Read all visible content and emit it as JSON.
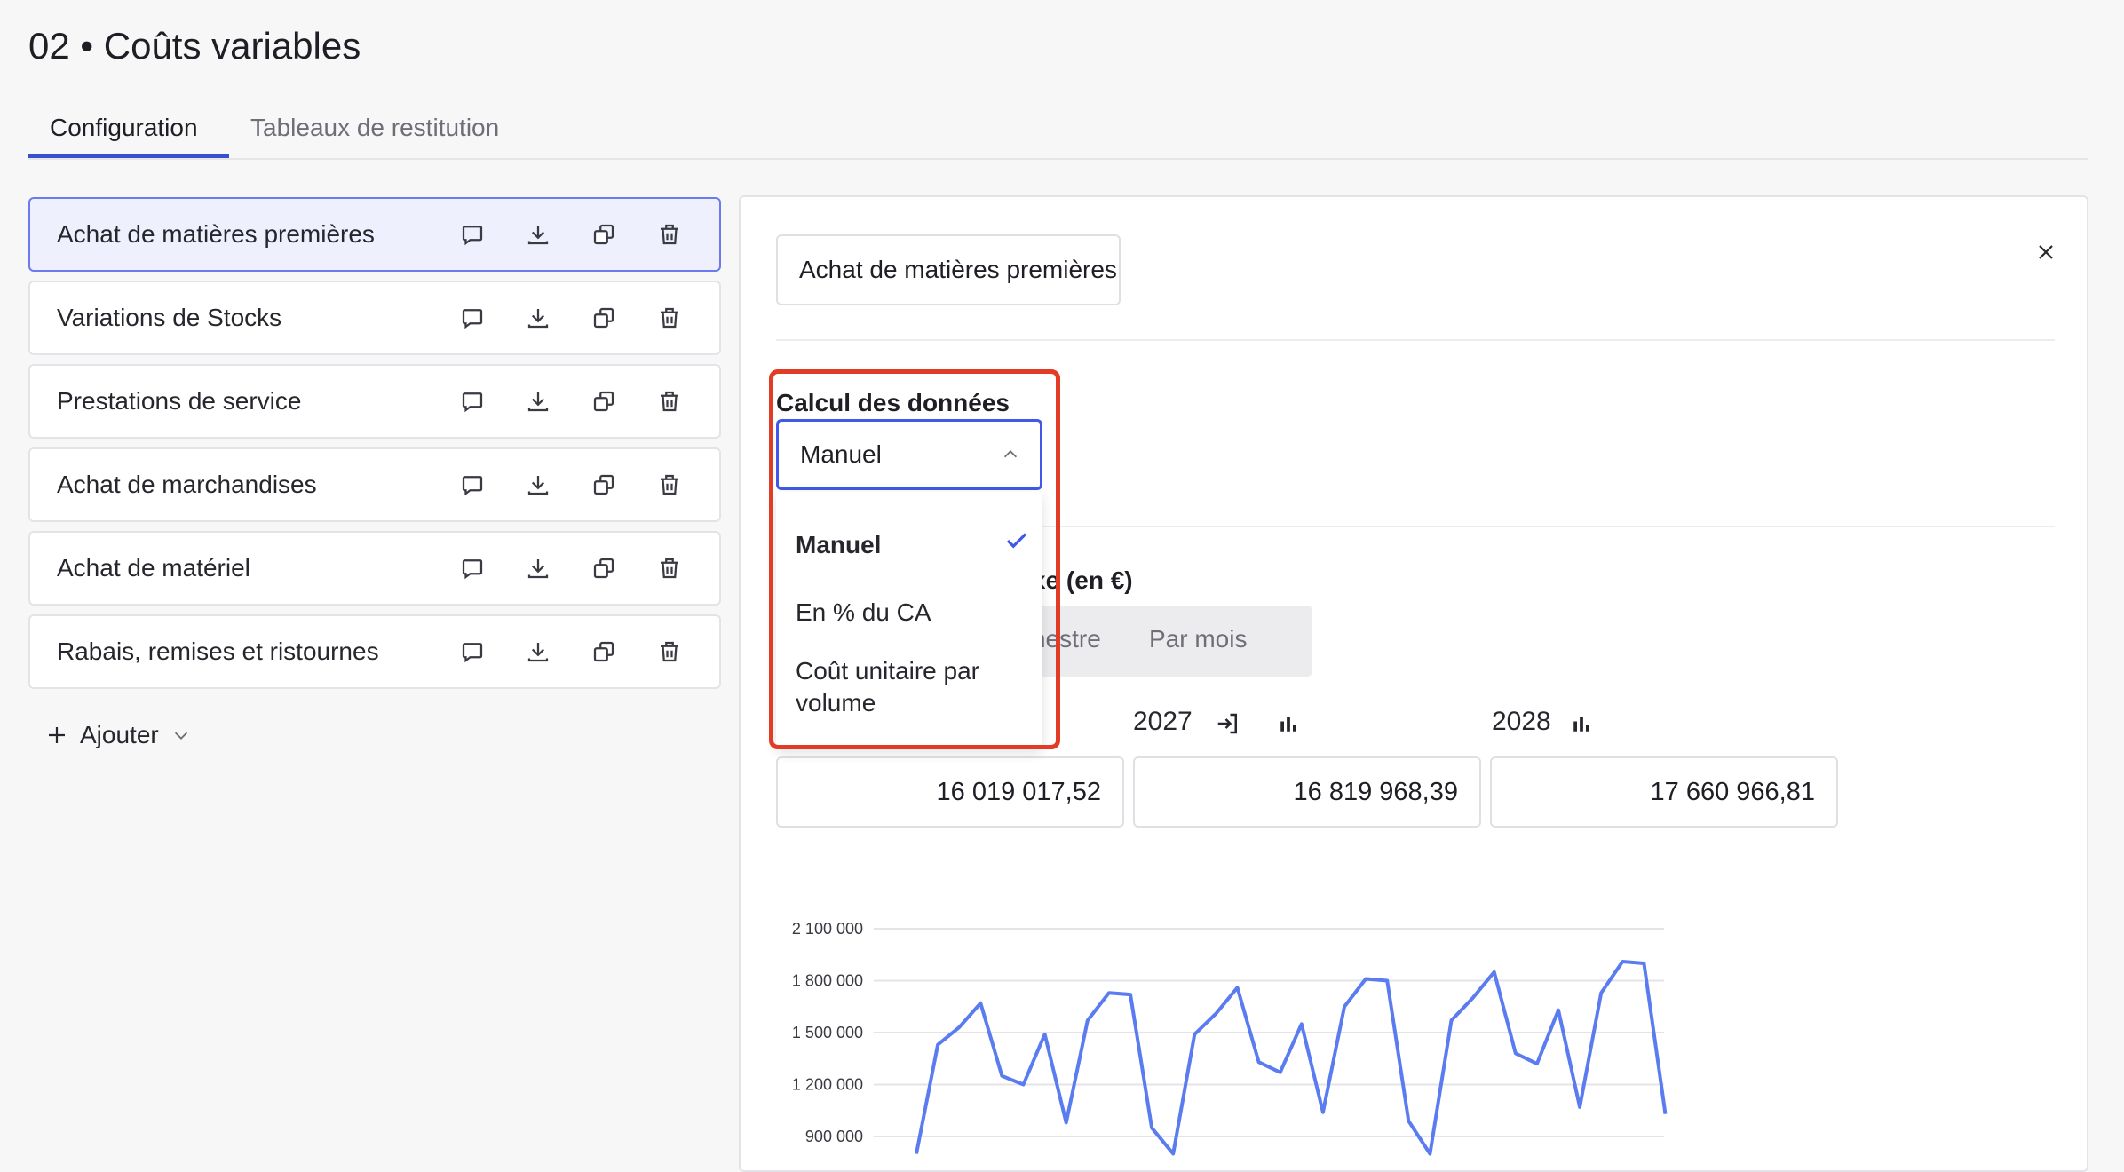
{
  "page": {
    "title": "02 • Coûts variables",
    "tabs": [
      {
        "label": "Configuration",
        "active": true
      },
      {
        "label": "Tableaux de restitution",
        "active": false
      }
    ]
  },
  "sidebar": {
    "items": [
      {
        "label": "Achat de matières premières",
        "selected": true
      },
      {
        "label": "Variations de Stocks",
        "selected": false
      },
      {
        "label": "Prestations de service",
        "selected": false
      },
      {
        "label": "Achat de marchandises",
        "selected": false
      },
      {
        "label": "Achat de matériel",
        "selected": false
      },
      {
        "label": "Rabais, remises et ristournes",
        "selected": false
      }
    ],
    "item_icons": [
      "comment-icon",
      "download-icon",
      "duplicate-icon",
      "trash-icon"
    ],
    "add_label": "Ajouter"
  },
  "panel": {
    "name_value": "Achat de matières premières",
    "calc_label": "Calcul des données",
    "select_value": "Manuel",
    "dropdown_options": [
      {
        "label": "Manuel",
        "selected": true
      },
      {
        "label": "En % du CA",
        "selected": false
      },
      {
        "label": "Coût unitaire par volume",
        "selected": false
      }
    ],
    "partial_label": "xe (en €)",
    "segmented": {
      "left_partial": "imestre",
      "right": "Par mois"
    },
    "years": [
      {
        "label": "2027",
        "value": "16 819 968,39"
      },
      {
        "label": "2028",
        "value": "17 660 966,81"
      }
    ],
    "first_value": "16 019 017,52"
  },
  "colors": {
    "accent": "#4159e6",
    "highlight": "#e33c26",
    "line": "#5b7cf0",
    "selected_bg": "#eef0fd"
  },
  "chart_data": {
    "type": "line",
    "yticks": [
      "2 100 000",
      "1 800 000",
      "1 500 000",
      "1 200 000",
      "900 000"
    ],
    "ylim": [
      800000,
      2100000
    ],
    "series": [
      {
        "values": [
          800000,
          1430000,
          1530000,
          1670000,
          1250000,
          1200000,
          1490000,
          980000,
          1570000,
          1730000,
          1720000,
          950000,
          800000,
          1490000,
          1610000,
          1760000,
          1330000,
          1270000,
          1550000,
          1040000,
          1650000,
          1810000,
          1800000,
          990000,
          800000,
          1570000,
          1700000,
          1850000,
          1380000,
          1320000,
          1630000,
          1070000,
          1730000,
          1910000,
          1900000,
          1030000
        ]
      }
    ]
  }
}
